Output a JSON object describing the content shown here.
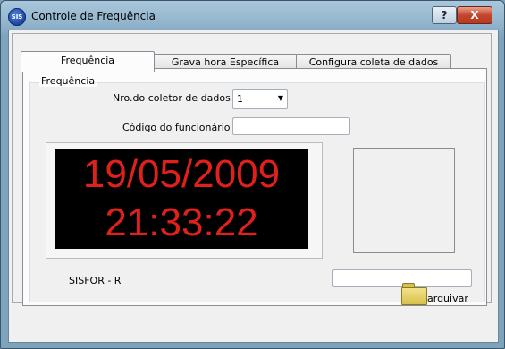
{
  "window": {
    "title": "Controle de Frequência",
    "icon_text": "SIS",
    "help_label": "?",
    "close_label": "X"
  },
  "tabs": [
    {
      "label": "Frequência",
      "active": true
    },
    {
      "label": "Grava hora Específica",
      "active": false
    },
    {
      "label": "Configura coleta de dados",
      "active": false
    }
  ],
  "panel": {
    "group_label": "Frequência",
    "collector_label": "Nro.do coletor de dados :",
    "collector_value": "1",
    "employee_label": "Código do funcionário :",
    "employee_value": "",
    "clock_date": "19/05/2009",
    "clock_time": "21:33:22",
    "brand_label": "SISFOR - R",
    "name_value": ""
  },
  "footer": {
    "archive_label": "arquivar"
  },
  "colors": {
    "clock_text": "#e0201a",
    "clock_bg": "#000000"
  }
}
